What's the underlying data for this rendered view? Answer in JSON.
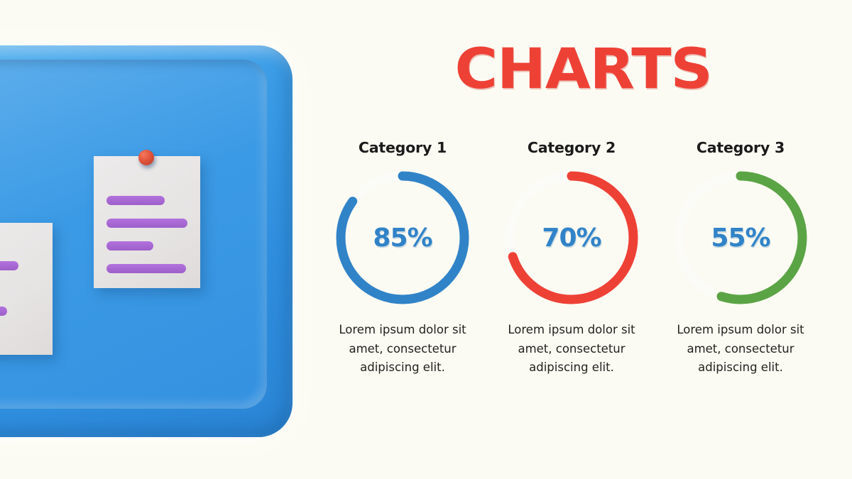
{
  "slide": {
    "title": "CHARTS",
    "background_color": "#fcfbf3",
    "accent_red": "#ee4136",
    "accent_blue": "#3183c8",
    "accent_green": "#5ba445",
    "track_color": "#fbfbf7"
  },
  "illustration": {
    "name": "blue-bulletin-board-with-sticky-notes",
    "board_color": "#3b9ae5",
    "note_color": "#e8e6e5",
    "pin_color": "#e1543c",
    "text_line_color": "#a865d2",
    "notes": [
      {
        "name": "sticky-note-main",
        "lines": [
          80,
          105,
          65,
          100
        ]
      },
      {
        "name": "sticky-note-side",
        "lines": [
          95,
          50,
          78,
          30
        ]
      }
    ]
  },
  "chart_data": {
    "type": "pie",
    "title": "CHARTS",
    "variant": "donut-progress-rings",
    "legend_position": "above-each-chart",
    "categories": [
      "Category 1",
      "Category 2",
      "Category 3"
    ],
    "values": [
      85,
      70,
      55
    ],
    "unit": "%",
    "colors": [
      "#3183c8",
      "#ee4136",
      "#5ba445"
    ],
    "track_color": "#fbfbf7",
    "start_angle_deg": 0,
    "direction": "clockwise",
    "max": 100,
    "descriptions": [
      "Lorem ipsum dolor sit amet, consectetur adipiscing elit.",
      "Lorem ipsum dolor sit amet, consectetur adipiscing elit.",
      "Lorem ipsum dolor sit amet, consectetur adipiscing elit."
    ],
    "value_labels": [
      "85%",
      "70%",
      "55%"
    ]
  }
}
